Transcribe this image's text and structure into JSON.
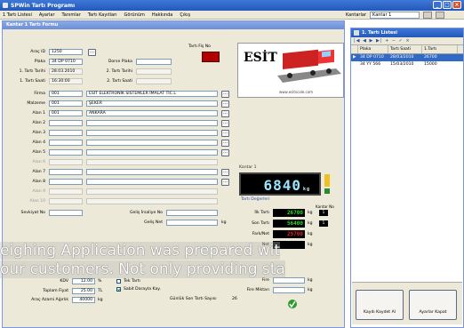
{
  "app": {
    "title": "SPWin Tartı Programı",
    "window_buttons": [
      "_",
      "□",
      "×"
    ]
  },
  "menubar": {
    "items": [
      "1 Tartı Listesi",
      "Ayarlar",
      "Tanımlar",
      "Tartı Kayıtları",
      "Görünüm",
      "Hakkında",
      "Çıkış"
    ],
    "kantar_label": "Kantarlar",
    "kantar_value": "Kantar 1"
  },
  "form": {
    "title": "Kantar 1 Tartı Formu",
    "arac_id_label": "Araç ID",
    "arac_id_value": "1250",
    "tarti_fis_no_label": "Tartı Fiş No",
    "plaka_label": "Plaka",
    "plaka_value": "34 DP 0710",
    "dorse_plaka_label": "Dorse Plaka",
    "t1_tarih_label": "1. Tartı Tarihi",
    "t1_tarih_value": "28.03.2010",
    "t2_tarih_label": "2. Tartı Tarihi",
    "t1_saat_label": "1. Tartı Saati",
    "t1_saat_value": "16:30:00",
    "t2_saat_label": "2. Tartı Saati",
    "firma_label": "Firma",
    "firma_code": "001",
    "firma_name": "ESİT ELEKTRONİK SİSTEMLER İMALAT TİC.L",
    "malzeme_label": "Malzeme",
    "malzeme_code": "001",
    "malzeme_name": "ŞEKER",
    "alan1_label": "Alan 1",
    "alan1_code": "001",
    "alan1_name": "ANKARA",
    "alan_labels": [
      "Alan 2",
      "Alan 3",
      "Alan 4",
      "Alan 5",
      "Alan 6",
      "Alan 7",
      "Alan 8",
      "Alan 9",
      "Alan 10"
    ],
    "sevk_label": "Sevkiyat No",
    "gelis_irsaliye_label": "Geliş İrsaliye No",
    "gelis_net_label": "Geliş Net",
    "kg": "kg",
    "kdv_label": "KDV",
    "kdv_value": "12.00",
    "kdv_unit": "%",
    "toplam_label": "Toplam Fiyat",
    "toplam_value": "25.00",
    "toplam_unit": "TL",
    "arac_azami_label": "Araç Azami Ağırlık",
    "arac_azami_value": "40000",
    "tek_tarti_label": "Tek Tartı",
    "sabit_dara_label": "Sabit Darayla Kay.",
    "gunluk_label": "Günlük Son Tartı Sayısı",
    "gunluk_value": "26"
  },
  "logo": {
    "brand": "ESİT",
    "url": "www.esitscale.com"
  },
  "scale": {
    "label": "Kantar 1",
    "weight": "6840",
    "unit": "kg"
  },
  "tarti_degerleri": {
    "title": "Tartı Değerleri",
    "kantar_no_label": "Kantar No",
    "rows": [
      {
        "label": "İlk Tartı",
        "value": "26700",
        "color": "#22dd22",
        "unit": "kg",
        "kantar": "1"
      },
      {
        "label": "Son Tartı",
        "value": "56400",
        "color": "#22dd22",
        "unit": "kg",
        "kantar": "1"
      },
      {
        "label": "Fark/Net",
        "value": "29700",
        "color": "#dd2222",
        "unit": "kg",
        "kantar": ""
      },
      {
        "label": "Net",
        "value": "",
        "color": "#dd2222",
        "unit": "kg",
        "kantar": ""
      }
    ],
    "fire_label": "Fire",
    "fire_net_label": "Fire Miktarı",
    "kg": "kg"
  },
  "list": {
    "title": "1. Tartı Listesi",
    "nav": "|◀ ◀ ▶ ▶| + − ✓ ×",
    "columns": [
      "",
      "Plaka",
      "Tartı Saati",
      "1.Tartı"
    ],
    "rows": [
      {
        "mark": "▶",
        "plaka": "34 DP 0710",
        "tarih": "28/03/2010",
        "deger": "26700"
      },
      {
        "mark": "",
        "plaka": "34 YY 566",
        "tarih": "15/03/2010",
        "deger": "15000"
      }
    ],
    "btn_left": "Kaydı Kaydet Al",
    "btn_right": "Ayarlar Kapat"
  },
  "caption": {
    "line1": "eighing Application was prepared wit",
    "line2": "our customers. Not only providing sta"
  }
}
